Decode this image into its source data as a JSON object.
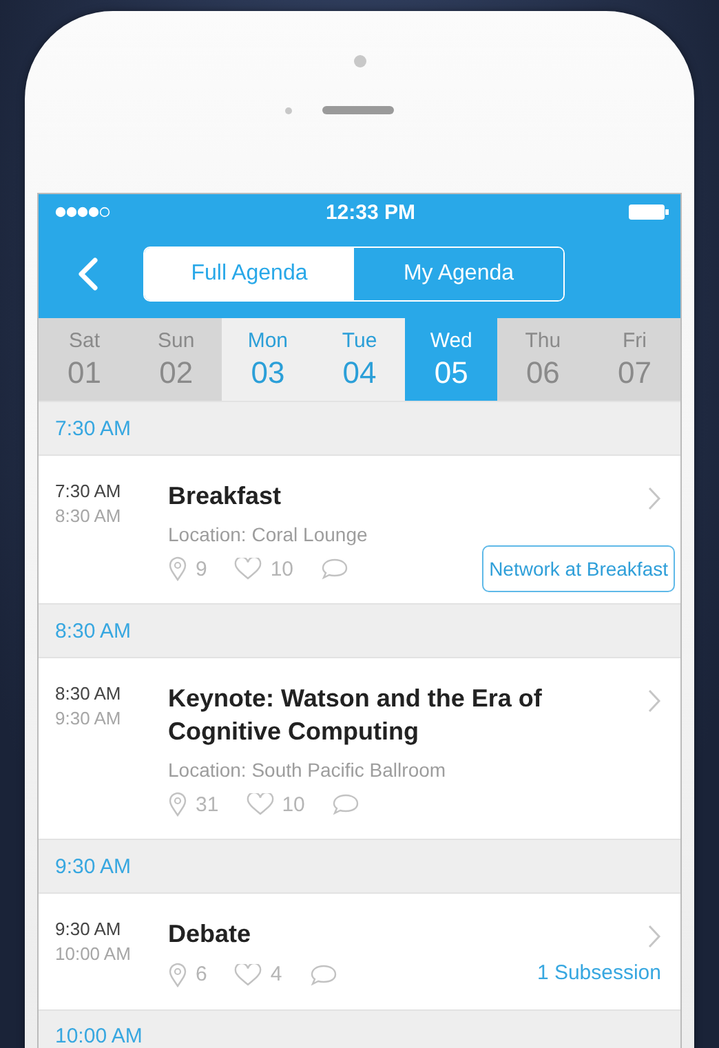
{
  "status_bar": {
    "time": "12:33 PM"
  },
  "segments": [
    {
      "label": "Full Agenda",
      "selected": true
    },
    {
      "label": "My Agenda",
      "selected": false
    }
  ],
  "days": [
    {
      "weekday": "Sat",
      "date": "01",
      "available": false,
      "selected": false
    },
    {
      "weekday": "Sun",
      "date": "02",
      "available": false,
      "selected": false
    },
    {
      "weekday": "Mon",
      "date": "03",
      "available": true,
      "selected": false
    },
    {
      "weekday": "Tue",
      "date": "04",
      "available": true,
      "selected": false
    },
    {
      "weekday": "Wed",
      "date": "05",
      "available": true,
      "selected": true
    },
    {
      "weekday": "Thu",
      "date": "06",
      "available": false,
      "selected": false
    },
    {
      "weekday": "Fri",
      "date": "07",
      "available": false,
      "selected": false
    }
  ],
  "slots": [
    {
      "time": "7:30 AM",
      "sessions": [
        {
          "start": "7:30 AM",
          "end": "8:30 AM",
          "title": "Breakfast",
          "location": "Location: Coral Lounge",
          "checkins": "9",
          "likes": "10",
          "action": {
            "kind": "button",
            "label": "Network at Breakfast"
          }
        }
      ]
    },
    {
      "time": "8:30 AM",
      "sessions": [
        {
          "start": "8:30 AM",
          "end": "9:30 AM",
          "title": "Keynote: Watson and the Era of Cognitive Computing",
          "location": "Location: South Pacific Ballroom",
          "checkins": "31",
          "likes": "10"
        }
      ]
    },
    {
      "time": "9:30 AM",
      "sessions": [
        {
          "start": "9:30 AM",
          "end": "10:00 AM",
          "title": "Debate",
          "checkins": "6",
          "likes": "4",
          "action": {
            "kind": "link",
            "label": "1 Subsession"
          }
        }
      ]
    },
    {
      "time": "10:00 AM"
    }
  ]
}
